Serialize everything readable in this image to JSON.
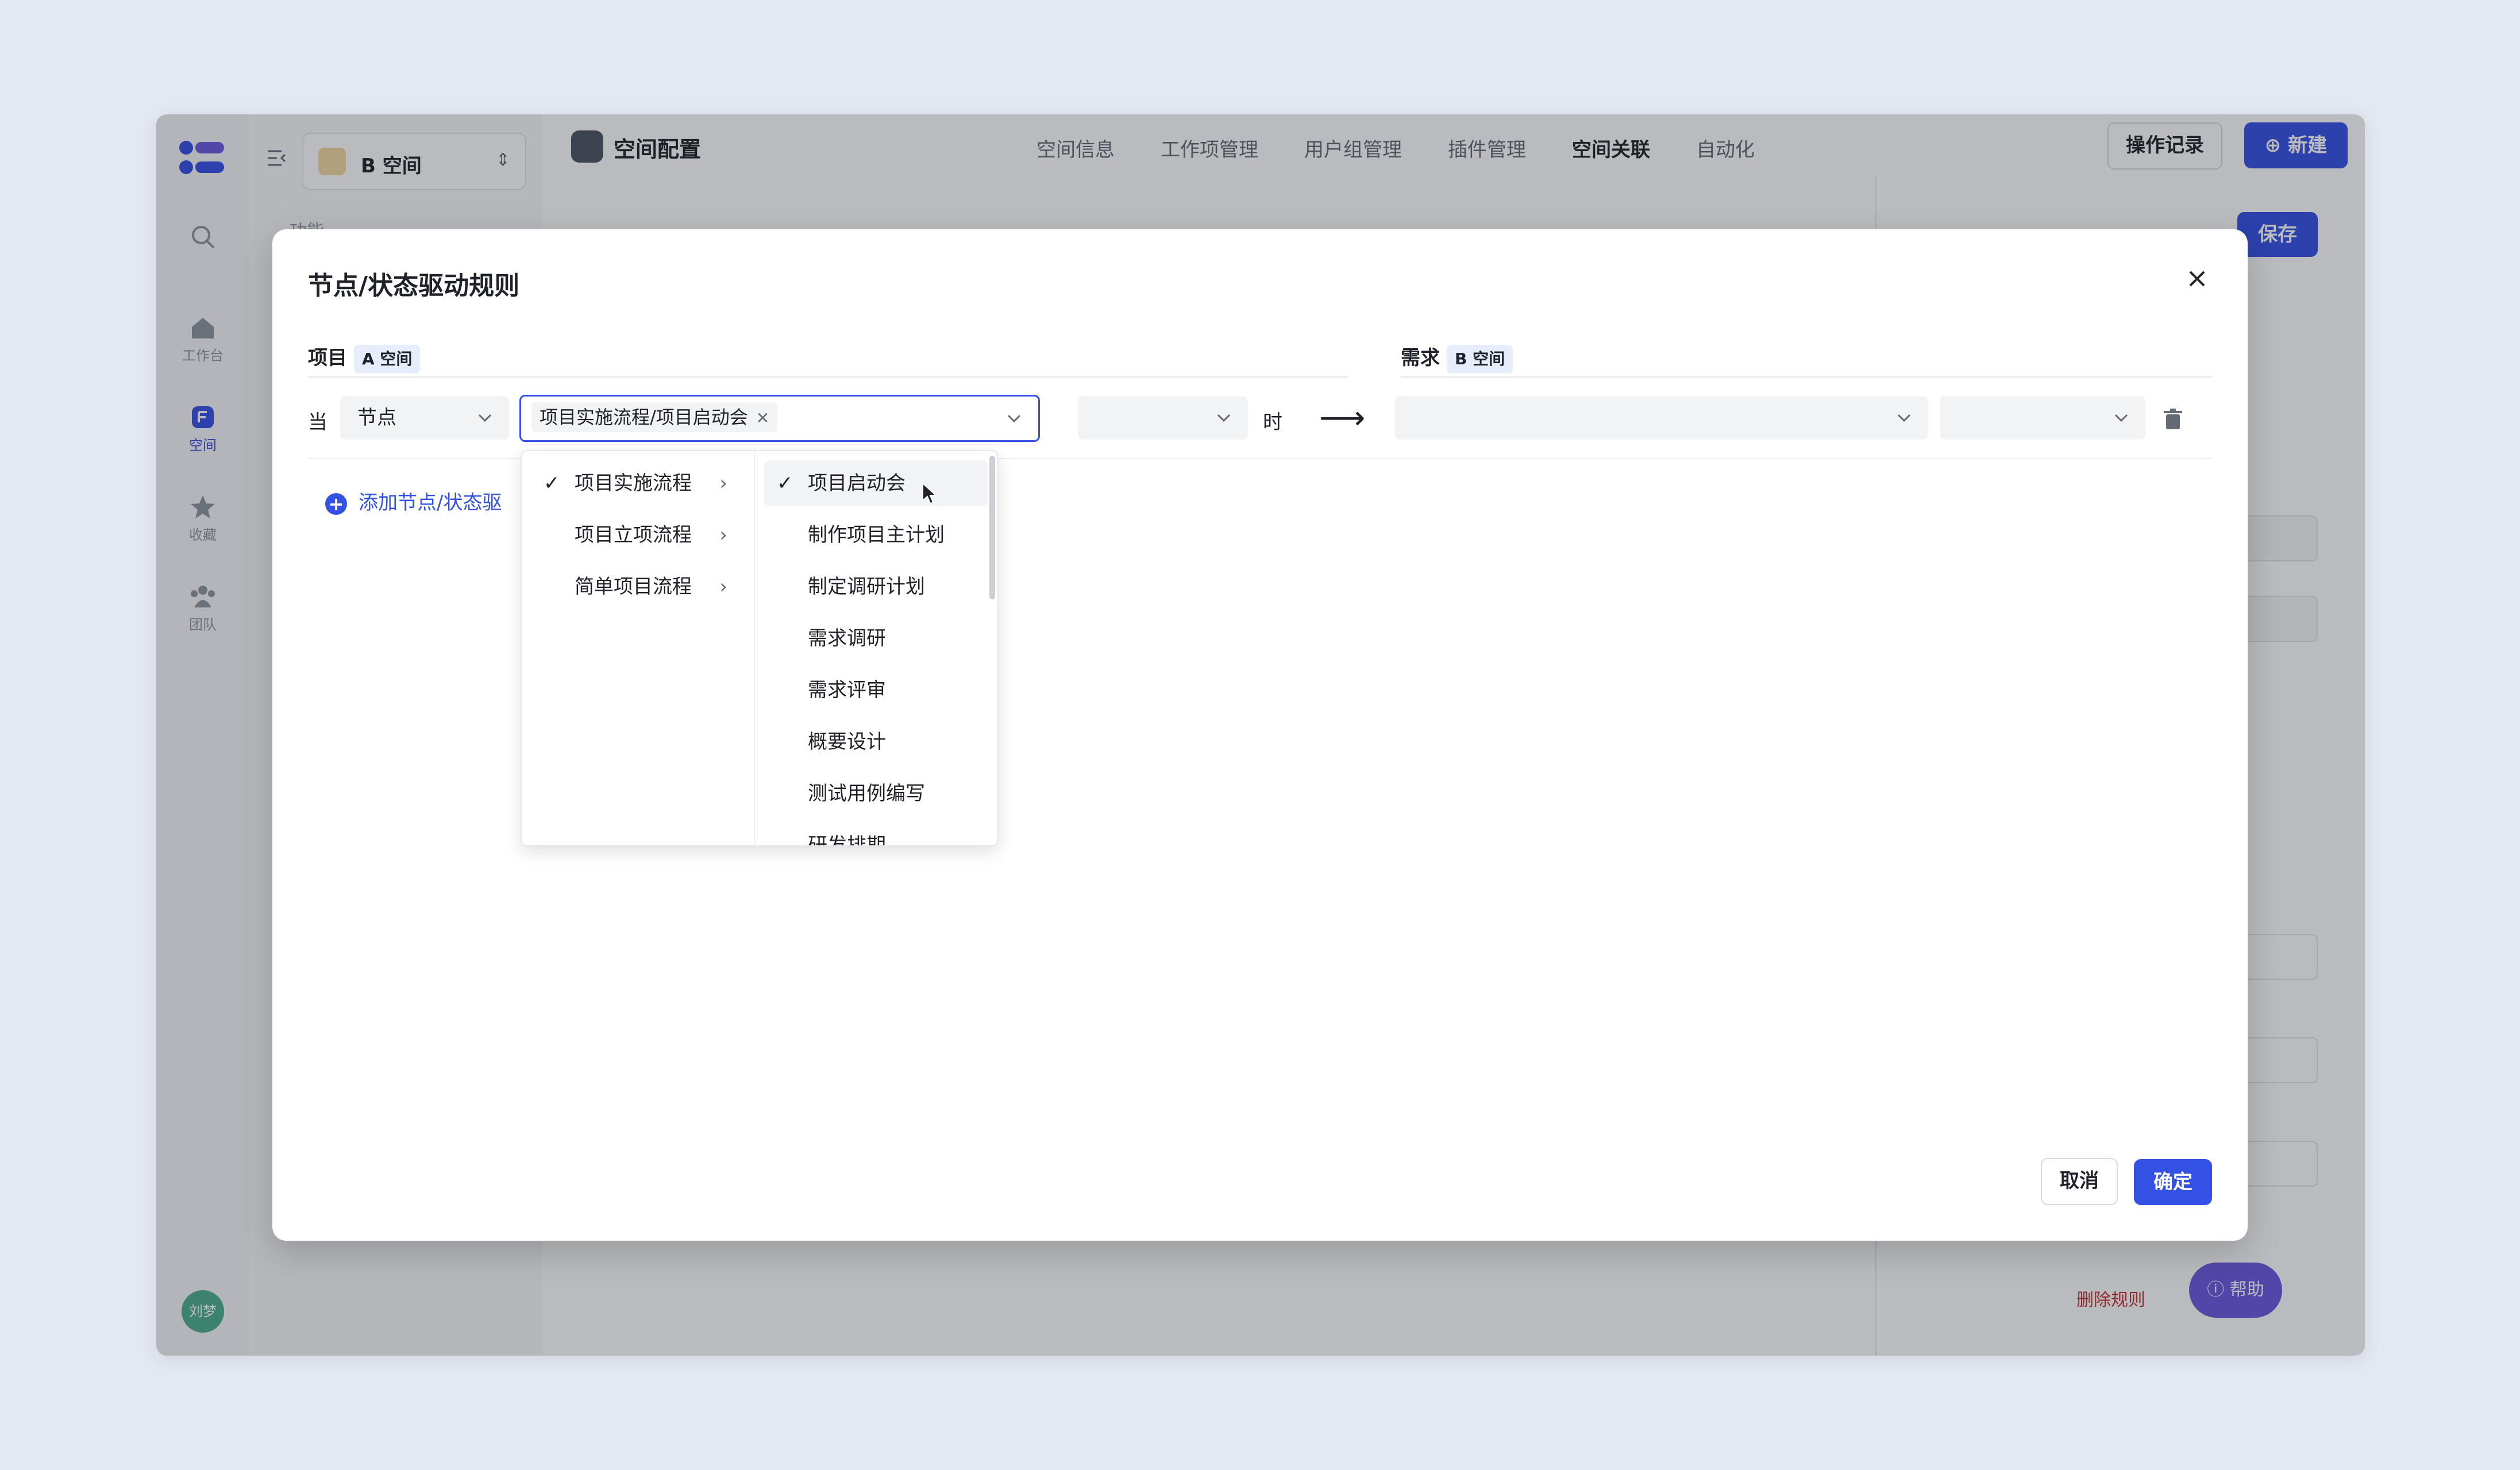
{
  "app": {
    "space_name": "B 空间",
    "nav_label": "功能",
    "rail": {
      "workbench": "工作台",
      "space": "空间",
      "favorites": "收藏",
      "team": "团队",
      "avatar": "刘梦"
    },
    "header": {
      "title": "空间配置",
      "tabs": [
        "空间信息",
        "工作项管理",
        "用户组管理",
        "插件管理",
        "空间关联",
        "自动化"
      ],
      "active_tab": "空间关联",
      "record_button": "操作记录",
      "new_button": "新建"
    },
    "right_panel": {
      "save_button": "保存",
      "delete_rule": "删除规则"
    },
    "help_button": "帮助"
  },
  "modal": {
    "title": "节点/状态驱动规则",
    "left_section": {
      "label": "项目",
      "tag": "A 空间"
    },
    "right_section": {
      "label": "需求",
      "tag": "B 空间"
    },
    "when_label": "当",
    "type_select": "节点",
    "selected_chip": "项目实施流程/项目启动会",
    "time_label": "时",
    "arrow": "⟶",
    "add_link": "添加节点/状态驱",
    "cancel_button": "取消",
    "ok_button": "确定"
  },
  "dropdown": {
    "flows": [
      {
        "label": "项目实施流程",
        "checked": true
      },
      {
        "label": "项目立项流程",
        "checked": false
      },
      {
        "label": "简单项目流程",
        "checked": false
      }
    ],
    "nodes": [
      {
        "label": "项目启动会",
        "checked": true
      },
      {
        "label": "制作项目主计划",
        "checked": false
      },
      {
        "label": "制定调研计划",
        "checked": false
      },
      {
        "label": "需求调研",
        "checked": false
      },
      {
        "label": "需求评审",
        "checked": false
      },
      {
        "label": "概要设计",
        "checked": false
      },
      {
        "label": "测试用例编写",
        "checked": false
      },
      {
        "label": "研发排期",
        "checked": false
      }
    ]
  },
  "colors": {
    "accent": "#3451e6",
    "help": "#6a5ae0",
    "avatar": "#4dae8f"
  }
}
